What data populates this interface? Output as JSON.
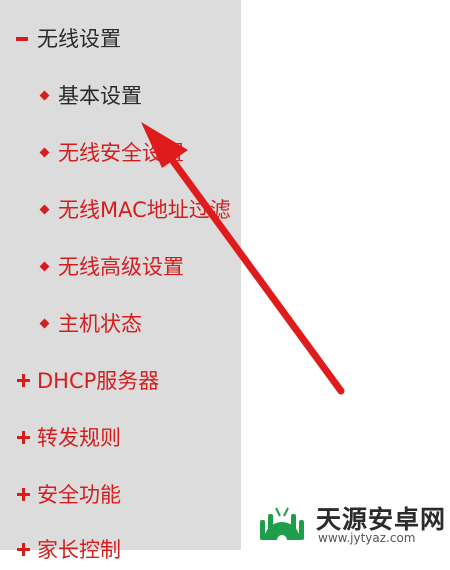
{
  "menu": {
    "wireless_group": {
      "label": "无线设置",
      "items": [
        {
          "label": "基本设置"
        },
        {
          "label": "无线安全设置"
        },
        {
          "label": "无线MAC地址过滤"
        },
        {
          "label": "无线高级设置"
        },
        {
          "label": "主机状态"
        }
      ]
    },
    "top_items": [
      {
        "label": "DHCP服务器"
      },
      {
        "label": "转发规则"
      },
      {
        "label": "安全功能"
      },
      {
        "label": "家长控制"
      }
    ]
  },
  "watermark": {
    "name": "天源安卓网",
    "url": "www.jytyaz.com"
  },
  "colors": {
    "accent": "#d41e1e",
    "sidebar_bg": "#dcdcdc",
    "arrow": "#e01b1b"
  }
}
